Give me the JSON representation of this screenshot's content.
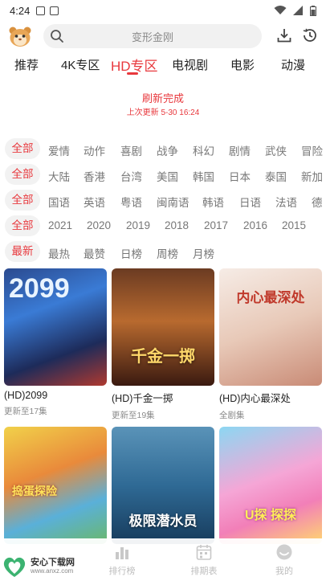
{
  "status_bar": {
    "time": "4:24"
  },
  "search": {
    "placeholder": "变形金刚"
  },
  "tabs": [
    {
      "label": "推荐",
      "active": false
    },
    {
      "label": "4K专区",
      "active": false
    },
    {
      "label": "HD专区",
      "active": true
    },
    {
      "label": "电视剧",
      "active": false
    },
    {
      "label": "电影",
      "active": false
    },
    {
      "label": "动漫",
      "active": false
    }
  ],
  "refresh": {
    "title": "刷新完成",
    "time": "上次更新 5-30 16:24"
  },
  "filters": [
    {
      "selected": "全部",
      "options": [
        "爱情",
        "动作",
        "喜剧",
        "战争",
        "科幻",
        "剧情",
        "武侠",
        "冒险"
      ]
    },
    {
      "selected": "全部",
      "options": [
        "大陆",
        "香港",
        "台湾",
        "美国",
        "韩国",
        "日本",
        "泰国",
        "新加"
      ]
    },
    {
      "selected": "全部",
      "options": [
        "国语",
        "英语",
        "粤语",
        "闽南语",
        "韩语",
        "日语",
        "法语",
        "德"
      ]
    },
    {
      "selected": "全部",
      "options": [
        "2021",
        "2020",
        "2019",
        "2018",
        "2017",
        "2016",
        "2015"
      ]
    },
    {
      "selected": "最新",
      "options": [
        "最热",
        "最赞",
        "日榜",
        "周榜",
        "月榜"
      ]
    }
  ],
  "items": [
    {
      "poster_text": "2099",
      "title": "(HD)2099",
      "sub": "更新至17集"
    },
    {
      "poster_text": "千金一掷",
      "title": "(HD)千金一掷",
      "sub": "更新至19集"
    },
    {
      "poster_text": "内心最深处",
      "title": "(HD)内心最深处",
      "sub": "全剧集"
    },
    {
      "poster_text": "捣蛋探险",
      "title": "",
      "sub": ""
    },
    {
      "poster_text": "极限潜水员",
      "title": "",
      "sub": ""
    },
    {
      "poster_text": "U探 探探",
      "title": "",
      "sub": ""
    }
  ],
  "bottom_nav": [
    {
      "label": "排行榜",
      "icon": "chart-icon"
    },
    {
      "label": "排期表",
      "icon": "calendar-icon"
    },
    {
      "label": "我的",
      "icon": "user-icon"
    }
  ],
  "watermark": {
    "line1": "安心下载网",
    "line2": "www.anxz.com"
  },
  "colors": {
    "accent": "#e8383d",
    "muted": "#777777",
    "pill_bg": "#f2f2f2"
  }
}
